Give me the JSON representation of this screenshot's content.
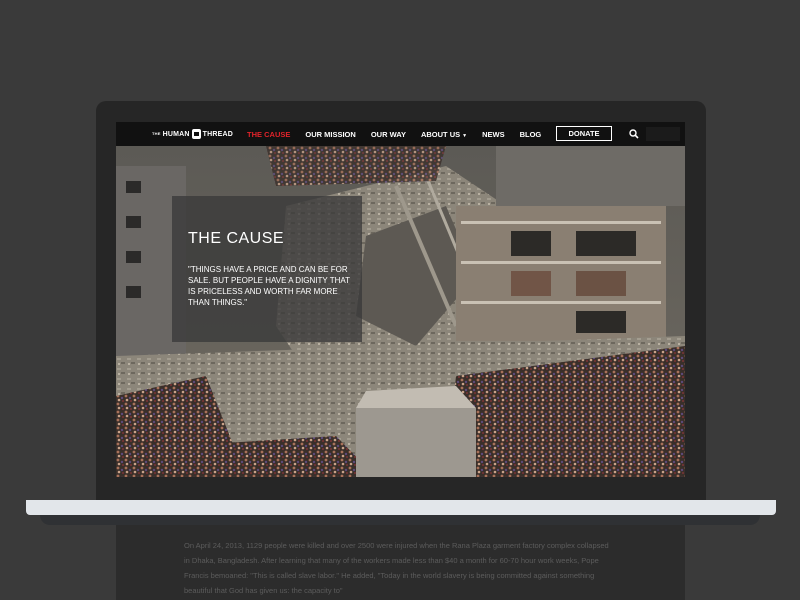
{
  "nav": {
    "logo_the": "THE",
    "logo_name_left": "HUMAN",
    "logo_name_right": "THREAD",
    "items": [
      {
        "label": "THE CAUSE",
        "active": true
      },
      {
        "label": "OUR MISSION"
      },
      {
        "label": "OUR WAY"
      },
      {
        "label": "ABOUT US"
      },
      {
        "label": "NEWS"
      },
      {
        "label": "BLOG"
      }
    ],
    "donate_label": "DONATE",
    "search_icon": "search-icon",
    "accent_color": "#e0232a"
  },
  "hero": {
    "title": "THE CAUSE",
    "quote": "\"THINGS HAVE A PRICE AND CAN BE FOR SALE. BUT PEOPLE HAVE A DIGNITY THAT IS PRICELESS AND WORTH FAR MORE THAN THINGS.\""
  },
  "below": {
    "paragraph": "On April 24, 2013, 1129 people were killed and over 2500 were injured when the Rana Plaza garment factory complex collapsed in Dhaka, Bangladesh. After learning that many of the workers made less than $40 a month for 60-70 hour work weeks, Pope Francis bemoaned: \"This is called slave labor.\" He added, \"Today in the world slavery is being committed against something beautiful that God has given us: the capacity to\""
  }
}
